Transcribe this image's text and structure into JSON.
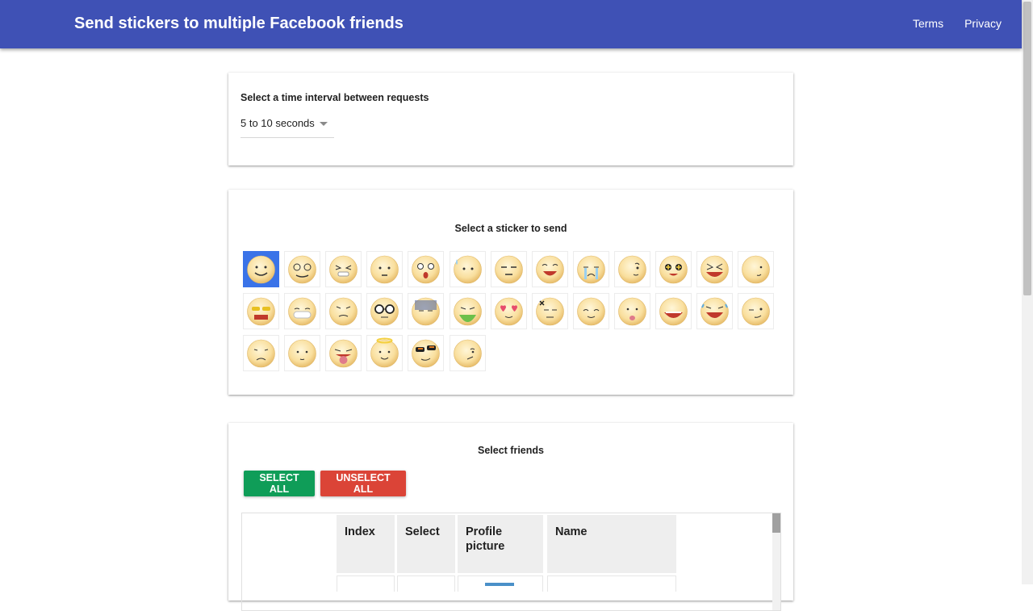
{
  "header": {
    "title": "Send stickers to multiple Facebook friends",
    "nav": {
      "terms": "Terms",
      "privacy": "Privacy"
    },
    "color": "#3f51b5"
  },
  "interval": {
    "label": "Select a time interval between requests",
    "selected": "5 to 10 seconds"
  },
  "stickers": {
    "title": "Select a sticker to send",
    "selected_index": 0,
    "items": [
      "smile",
      "dizzy",
      "grin-squint",
      "pout",
      "shocked",
      "sweat",
      "meh",
      "laugh",
      "cry",
      "curious",
      "starstruck",
      "xd",
      "hmm",
      "sunglasses-fangs",
      "big-grin",
      "worried",
      "nerd-glasses",
      "gloom",
      "vomit",
      "heart-eyes",
      "angry",
      "happy",
      "tongue",
      "open-mouth",
      "joy-tears",
      "wink",
      "sad",
      "calm",
      "tongue-out",
      "angel",
      "cool-shades",
      "confused"
    ]
  },
  "friends": {
    "title": "Select friends",
    "select_all": "SELECT ALL",
    "unselect_all": "UNSELECT ALL",
    "columns": [
      "Index",
      "Select",
      "Profile picture",
      "Name"
    ]
  }
}
